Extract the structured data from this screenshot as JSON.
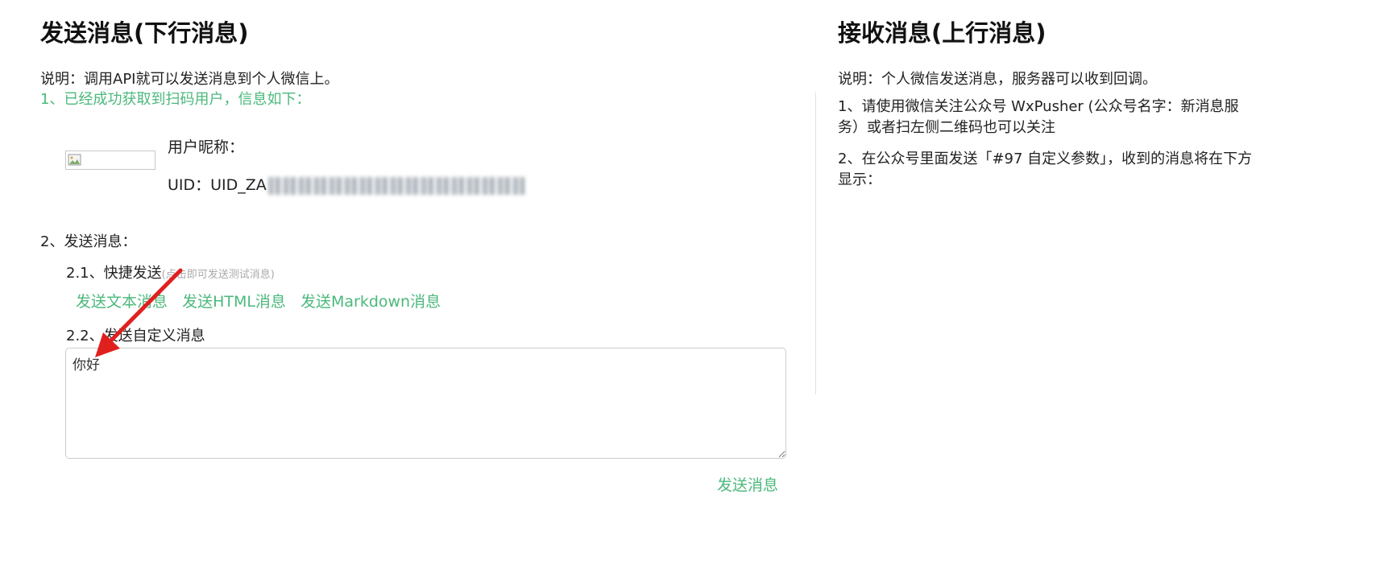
{
  "send_section": {
    "title": "发送消息(下行消息)",
    "description": "说明：调用API就可以发送消息到个人微信上。",
    "step1": "1、已经成功获取到扫码用户，信息如下：",
    "user": {
      "nickname_label": "用户昵称：",
      "uid_label": "UID：UID_ZA"
    },
    "step2": "2、发送消息：",
    "quick_send": {
      "label": "2.1、快捷发送",
      "hint": "(点击即可发送测试消息)",
      "links": [
        "发送文本消息",
        "发送HTML消息",
        "发送Markdown消息"
      ]
    },
    "custom_send": {
      "label": "2.2、发送自定义消息",
      "message_value": "你好",
      "send_label": "发送消息"
    }
  },
  "receive_section": {
    "title": "接收消息(上行消息)",
    "description": "说明：个人微信发送消息，服务器可以收到回调。",
    "step1": "1、请使用微信关注公众号 WxPusher (公众号名字：新消息服务）或者扫左侧二维码也可以关注",
    "step2": "2、在公众号里面发送「#97 自定义参数」，收到的消息将在下方显示："
  },
  "colors": {
    "accent_green": "#4cb87c",
    "annotation_arrow": "#e0201f"
  },
  "icons": {
    "avatar": "broken-image-icon",
    "annotation": "red-arrow-icon"
  }
}
